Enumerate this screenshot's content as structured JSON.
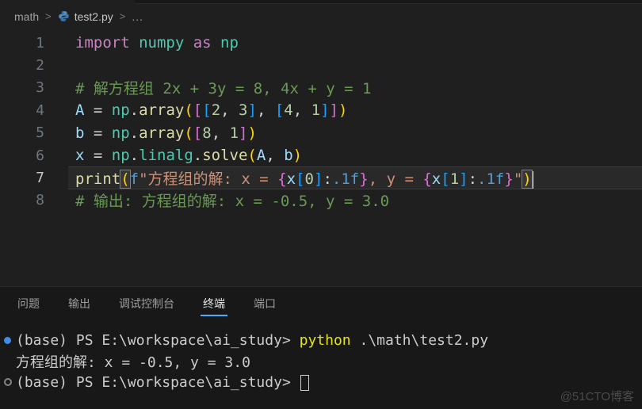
{
  "window": {
    "watermark": "@51CTO博客"
  },
  "breadcrumb": {
    "folder": "math",
    "sep": ">",
    "file": "test2.py",
    "ellipsis": "...",
    "file_icon": "python-icon"
  },
  "editor": {
    "lines": [
      {
        "num": "1",
        "tokens": [
          [
            "kw",
            "import "
          ],
          [
            "type",
            "numpy "
          ],
          [
            "kw",
            "as "
          ],
          [
            "type",
            "np"
          ]
        ]
      },
      {
        "num": "2",
        "tokens": []
      },
      {
        "num": "3",
        "tokens": [
          [
            "cmt",
            "# 解方程组 2x + 3y = 8, 4x + y = 1"
          ]
        ]
      },
      {
        "num": "4",
        "tokens": [
          [
            "var",
            "A"
          ],
          [
            "fg",
            " = "
          ],
          [
            "type",
            "np"
          ],
          [
            "fg",
            "."
          ],
          [
            "fn",
            "array"
          ],
          [
            "b1",
            "("
          ],
          [
            "b2",
            "["
          ],
          [
            "b3",
            "["
          ],
          [
            "num",
            "2"
          ],
          [
            "fg",
            ", "
          ],
          [
            "num",
            "3"
          ],
          [
            "b3",
            "]"
          ],
          [
            "fg",
            ", "
          ],
          [
            "b3",
            "["
          ],
          [
            "num",
            "4"
          ],
          [
            "fg",
            ", "
          ],
          [
            "num",
            "1"
          ],
          [
            "b3",
            "]"
          ],
          [
            "b2",
            "]"
          ],
          [
            "b1",
            ")"
          ]
        ]
      },
      {
        "num": "5",
        "tokens": [
          [
            "var",
            "b"
          ],
          [
            "fg",
            " = "
          ],
          [
            "type",
            "np"
          ],
          [
            "fg",
            "."
          ],
          [
            "fn",
            "array"
          ],
          [
            "b1",
            "("
          ],
          [
            "b2",
            "["
          ],
          [
            "num",
            "8"
          ],
          [
            "fg",
            ", "
          ],
          [
            "num",
            "1"
          ],
          [
            "b2",
            "]"
          ],
          [
            "b1",
            ")"
          ]
        ]
      },
      {
        "num": "6",
        "tokens": [
          [
            "var",
            "x"
          ],
          [
            "fg",
            " = "
          ],
          [
            "type",
            "np"
          ],
          [
            "fg",
            "."
          ],
          [
            "type",
            "linalg"
          ],
          [
            "fg",
            "."
          ],
          [
            "fn",
            "solve"
          ],
          [
            "b1",
            "("
          ],
          [
            "var",
            "A"
          ],
          [
            "fg",
            ", "
          ],
          [
            "var",
            "b"
          ],
          [
            "b1",
            ")"
          ]
        ]
      },
      {
        "num": "7",
        "current": true,
        "tokens": [
          [
            "fn",
            "print"
          ],
          [
            "b1 bm",
            "("
          ],
          [
            "fstr",
            "f"
          ],
          [
            "str",
            "\"方程组的解: x = "
          ],
          [
            "b2",
            "{"
          ],
          [
            "var",
            "x"
          ],
          [
            "b3",
            "["
          ],
          [
            "num",
            "0"
          ],
          [
            "b3",
            "]"
          ],
          [
            "fg",
            ":"
          ],
          [
            "fstr",
            ".1f"
          ],
          [
            "b2",
            "}"
          ],
          [
            "str",
            ", y = "
          ],
          [
            "b2",
            "{"
          ],
          [
            "var",
            "x"
          ],
          [
            "b3",
            "["
          ],
          [
            "num",
            "1"
          ],
          [
            "b3",
            "]"
          ],
          [
            "fg",
            ":"
          ],
          [
            "fstr",
            ".1f"
          ],
          [
            "b2",
            "}"
          ],
          [
            "str",
            "\""
          ],
          [
            "b1 bm",
            ")"
          ],
          [
            "cursor",
            ""
          ]
        ]
      },
      {
        "num": "8",
        "tokens": [
          [
            "cmt",
            "# 输出: 方程组的解: x = -0.5, y = 3.0"
          ]
        ]
      }
    ]
  },
  "panel": {
    "tabs": [
      {
        "label": "问题"
      },
      {
        "label": "输出"
      },
      {
        "label": "调试控制台"
      },
      {
        "label": "终端",
        "active": true
      },
      {
        "label": "端口"
      }
    ]
  },
  "terminal": {
    "rows": [
      {
        "bullet": "filled",
        "tokens": [
          [
            "tfg",
            "(base) PS E:\\workspace\\ai_study> "
          ],
          [
            "tyellow",
            "python"
          ],
          [
            "tfg",
            " .\\math\\test2.py"
          ]
        ]
      },
      {
        "bullet": "none",
        "tokens": [
          [
            "tfg",
            "方程组的解: x = -0.5, y = 3.0"
          ]
        ]
      },
      {
        "bullet": "hollow",
        "tokens": [
          [
            "tfg",
            "(base) PS E:\\workspace\\ai_study> "
          ],
          [
            "blockcursor",
            ""
          ]
        ]
      }
    ]
  },
  "colors": {
    "editorBg": "#1f1f1f",
    "panelBg": "#181818",
    "border": "#2b2b2b",
    "keyword": "#c586c0",
    "typename": "#4ec9b0",
    "func": "#dcdcaa",
    "variable": "#9cdcfe",
    "number": "#b5cea8",
    "string": "#ce9178",
    "comment": "#6a9955",
    "foreground": "#d4d4d4",
    "bracket1": "#ffd700",
    "bracket2": "#da70d6",
    "bracket3": "#179fff",
    "fstring": "#569cd6",
    "accent": "#4daafc",
    "terminalFg": "#cccccc",
    "terminalYellow": "#e5e510",
    "bulletBlue": "#3b8eea",
    "lineNumber": "#6e7681",
    "breadcrumbFg": "#a0a0a0",
    "currentLineBg": "#292929",
    "currentLineBorder": "#3a3a3a",
    "watermarkFg": "#4b4b4b"
  }
}
